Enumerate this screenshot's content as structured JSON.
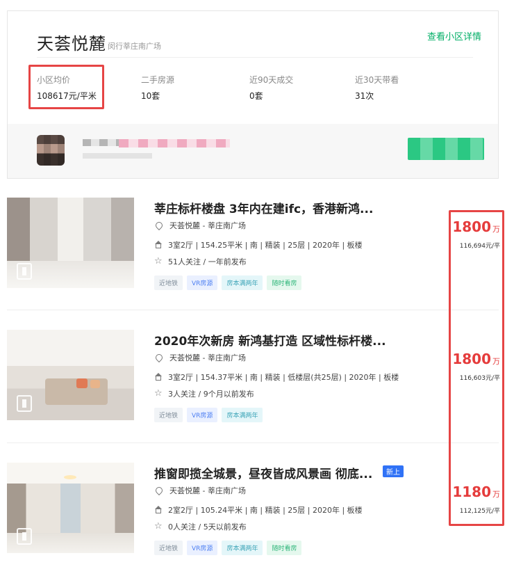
{
  "community": {
    "name": "天荟悦麓",
    "location": "闵行莘庄南广场",
    "detail_link": "查看小区详情",
    "stats": [
      {
        "label": "小区均价",
        "value": "108617元/平米"
      },
      {
        "label": "二手房源",
        "value": "10套"
      },
      {
        "label": "近90天成交",
        "value": "0套"
      },
      {
        "label": "近30天带看",
        "value": "31次"
      }
    ]
  },
  "listings": [
    {
      "title": "莘庄标杆楼盘 3年内在建ifc，香港新鸿...",
      "badge": "",
      "location": "天荟悦麓 - 莘庄南广场",
      "info": "3室2厅 | 154.25平米 | 南 | 精装 | 25层 | 2020年 | 板楼",
      "follow": "51人关注 / 一年前发布",
      "tags": [
        {
          "text": "近地铁",
          "style": "gray"
        },
        {
          "text": "VR房源",
          "style": "blue"
        },
        {
          "text": "房本满两年",
          "style": "cyan"
        },
        {
          "text": "随时看房",
          "style": "green"
        }
      ],
      "price": "1800",
      "price_unit": "万",
      "unit_price": "116,694元/平"
    },
    {
      "title": "2020年次新房 新鸿基打造 区域性标杆楼...",
      "badge": "",
      "location": "天荟悦麓 - 莘庄南广场",
      "info": "3室2厅 | 154.37平米 | 南 | 精装 | 低楼层(共25层) | 2020年 | 板楼",
      "follow": "3人关注 / 9个月以前发布",
      "tags": [
        {
          "text": "近地铁",
          "style": "gray"
        },
        {
          "text": "VR房源",
          "style": "blue"
        },
        {
          "text": "房本满两年",
          "style": "cyan"
        }
      ],
      "price": "1800",
      "price_unit": "万",
      "unit_price": "116,603元/平"
    },
    {
      "title": "推窗即揽全城景，昼夜皆成风景画 彻底...",
      "badge": "新上",
      "location": "天荟悦麓 - 莘庄南广场",
      "info": "2室2厅 | 105.24平米 | 南 | 精装 | 25层 | 2020年 | 板楼",
      "follow": "0人关注 / 5天以前发布",
      "tags": [
        {
          "text": "近地铁",
          "style": "gray"
        },
        {
          "text": "VR房源",
          "style": "blue"
        },
        {
          "text": "房本满两年",
          "style": "cyan"
        },
        {
          "text": "随时看房",
          "style": "green"
        }
      ],
      "price": "1180",
      "price_unit": "万",
      "unit_price": "112,125元/平"
    }
  ]
}
